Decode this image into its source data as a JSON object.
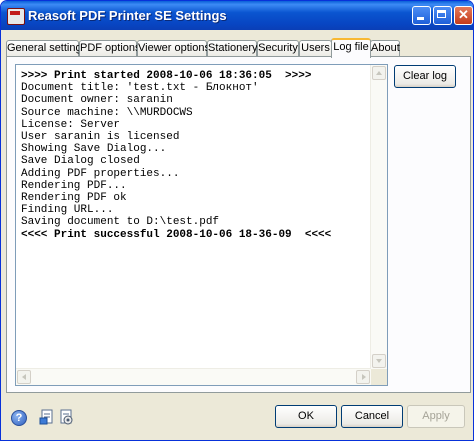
{
  "window": {
    "title": "Reasoft PDF Printer SE Settings"
  },
  "tabs": [
    {
      "label": "General settings",
      "active": false
    },
    {
      "label": "PDF options",
      "active": false
    },
    {
      "label": "Viewer options",
      "active": false
    },
    {
      "label": "Stationery",
      "active": false
    },
    {
      "label": "Security",
      "active": false
    },
    {
      "label": "Users",
      "active": false
    },
    {
      "label": "Log file",
      "active": true
    },
    {
      "label": "About",
      "active": false
    }
  ],
  "log": {
    "lines": [
      {
        "text": ">>>> Print started 2008-10-06 18:36:05  >>>>",
        "bold": true
      },
      {
        "text": "Document title: 'test.txt - Блокнот'",
        "bold": false
      },
      {
        "text": "Document owner: saranin",
        "bold": false
      },
      {
        "text": "Source machine: \\\\MURDOCWS",
        "bold": false
      },
      {
        "text": "License: Server",
        "bold": false
      },
      {
        "text": "User saranin is licensed",
        "bold": false
      },
      {
        "text": "Showing Save Dialog...",
        "bold": false
      },
      {
        "text": "Save Dialog closed",
        "bold": false
      },
      {
        "text": "Adding PDF properties...",
        "bold": false
      },
      {
        "text": "Rendering PDF...",
        "bold": false
      },
      {
        "text": "Rendering PDF ok",
        "bold": false
      },
      {
        "text": "Finding URL...",
        "bold": false
      },
      {
        "text": "Saving document to D:\\test.pdf",
        "bold": false
      },
      {
        "text": "<<<< Print successful 2008-10-06 18-36-09  <<<<",
        "bold": true
      }
    ]
  },
  "buttons": {
    "clear_log": "Clear log",
    "ok": "OK",
    "cancel": "Cancel",
    "apply": "Apply"
  },
  "icons": {
    "help": "?",
    "titlebar": "printer-icon"
  },
  "colors": {
    "titlebar": "#0a55d0",
    "tab_highlight": "#f8b832",
    "button_border": "#003c74"
  }
}
